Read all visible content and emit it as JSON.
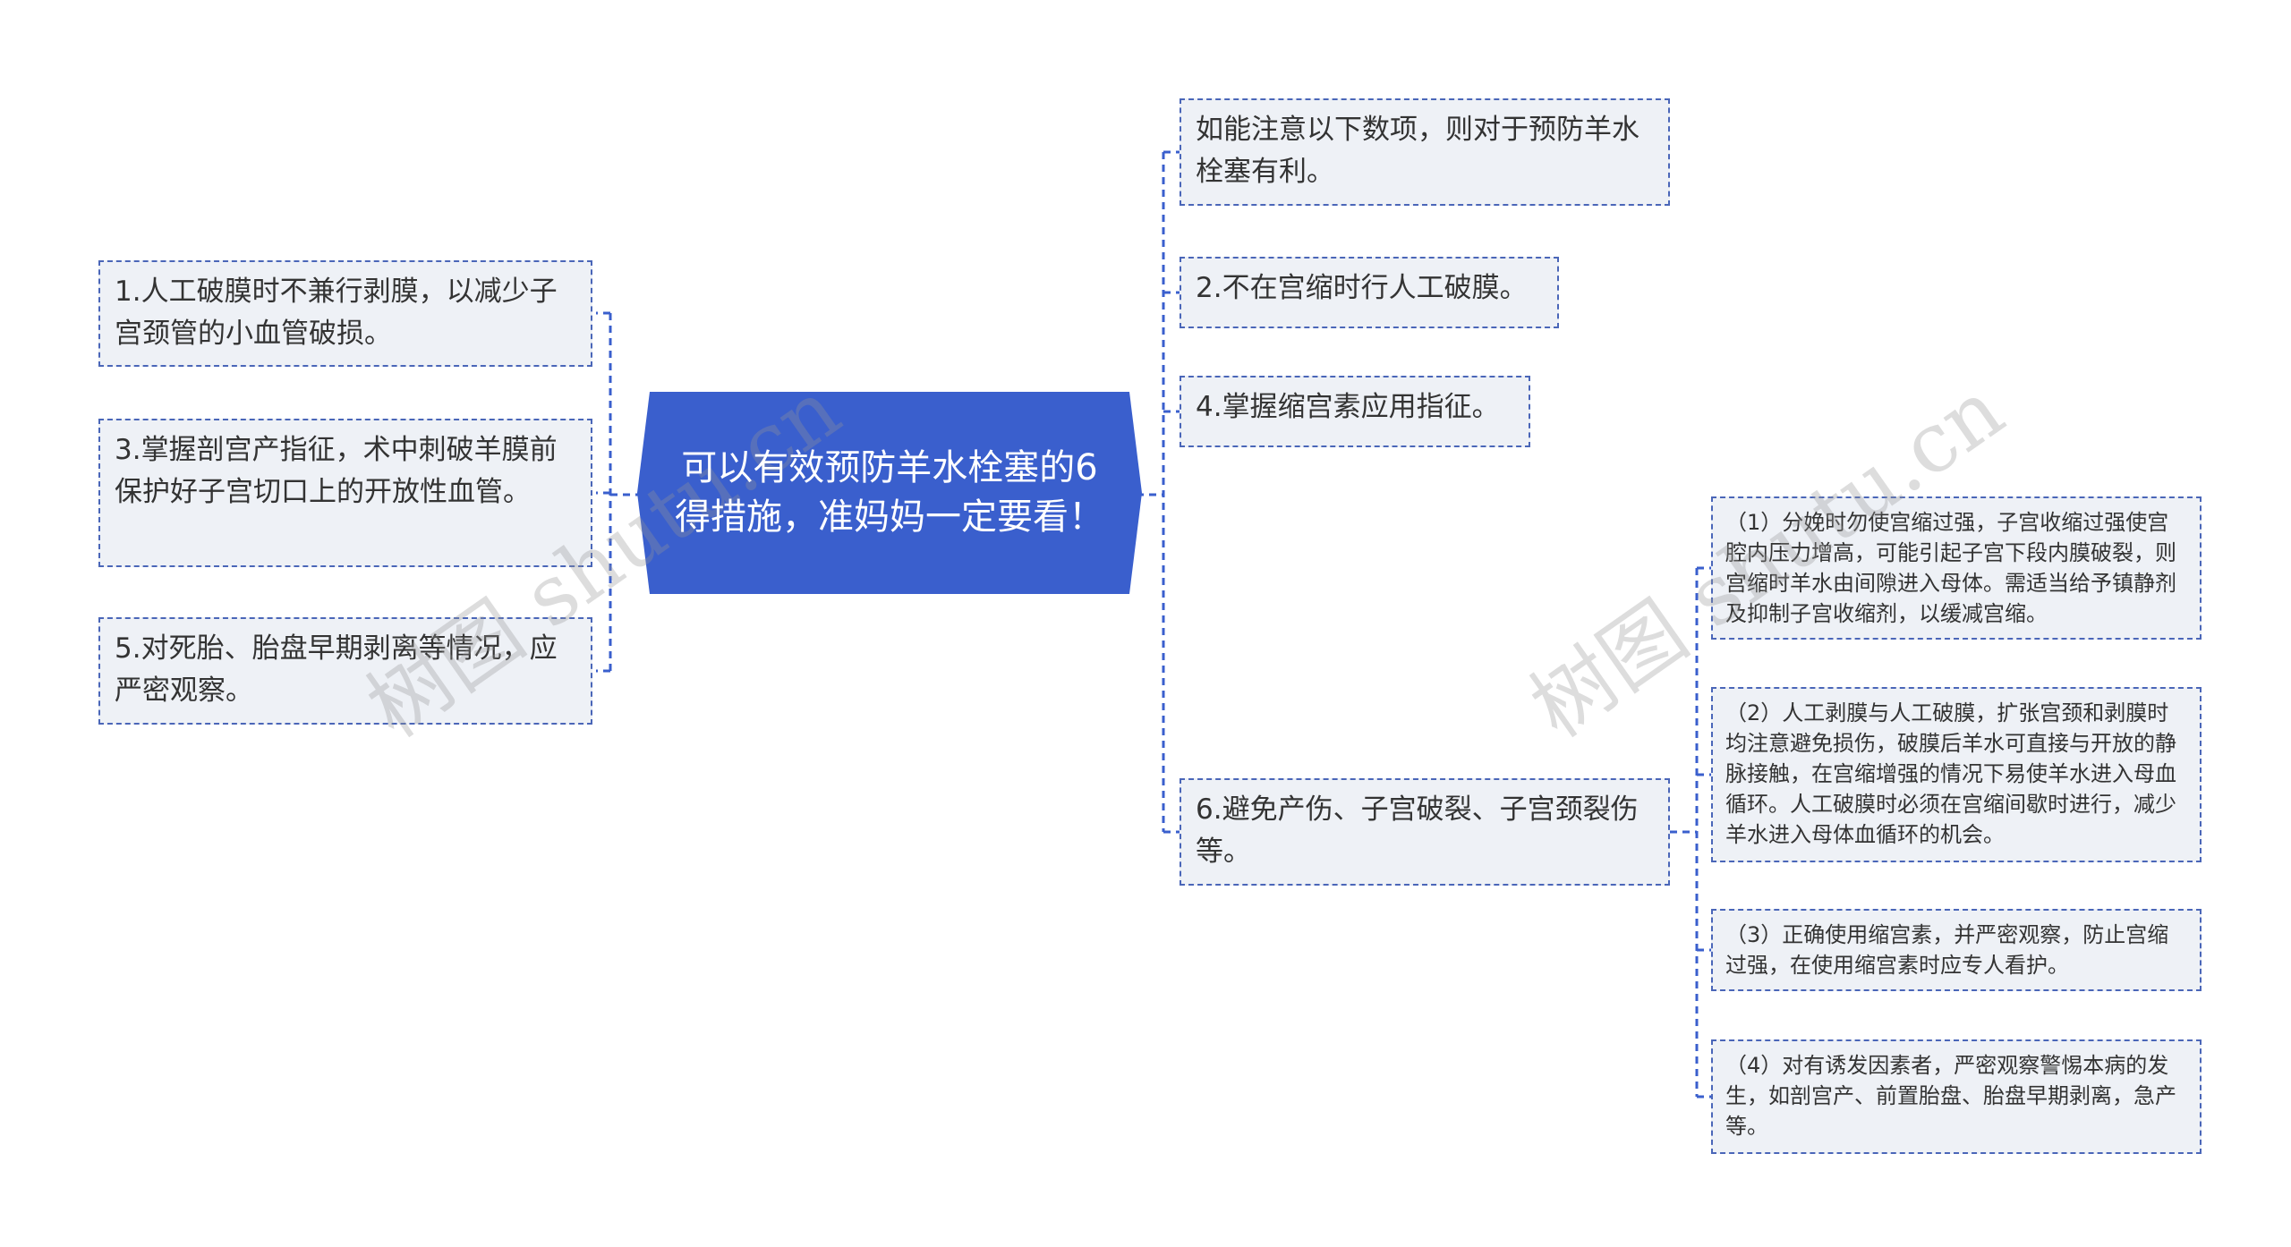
{
  "root": {
    "text": "可以有效预防羊水栓塞的6得措施，准妈妈一定要看！"
  },
  "left_nodes": [
    {
      "text": "1.人工破膜时不兼行剥膜，以减少子宫颈管的小血管破损。"
    },
    {
      "text": "3.掌握剖宫产指征，术中刺破羊膜前保护好子宫切口上的开放性血管。"
    },
    {
      "text": "5.对死胎、胎盘早期剥离等情况，应严密观察。"
    }
  ],
  "right_nodes": [
    {
      "text": "如能注意以下数项，则对于预防羊水栓塞有利。"
    },
    {
      "text": "2.不在宫缩时行人工破膜。"
    },
    {
      "text": "4.掌握缩宫素应用指征。"
    },
    {
      "text": "6.避免产伤、子宫破裂、子宫颈裂伤等。"
    }
  ],
  "sub_nodes": [
    {
      "text": "（1）分娩时勿使宫缩过强，子宫收缩过强使宫腔内压力增高，可能引起子宫下段内膜破裂，则宫缩时羊水由间隙进入母体。需适当给予镇静剂及抑制子宫收缩剂，以缓减宫缩。"
    },
    {
      "text": "（2）人工剥膜与人工破膜，扩张宫颈和剥膜时均注意避免损伤，破膜后羊水可直接与开放的静脉接触，在宫缩增强的情况下易使羊水进入母血循环。人工破膜时必须在宫缩间歇时进行，减少羊水进入母体血循环的机会。"
    },
    {
      "text": "（3）正确使用缩宫素，并严密观察，防止宫缩过强，在使用缩宫素时应专人看护。"
    },
    {
      "text": "（4）对有诱发因素者，严密观察警惕本病的发生，如剖宫产、前置胎盘、胎盘早期剥离，急产等。"
    }
  ],
  "watermark": "树图 shutu.cn",
  "colors": {
    "root_fill": "#3a5fcd",
    "node_fill": "#eef1f6",
    "border": "#4a66b8",
    "line": "#3a5fcd"
  }
}
